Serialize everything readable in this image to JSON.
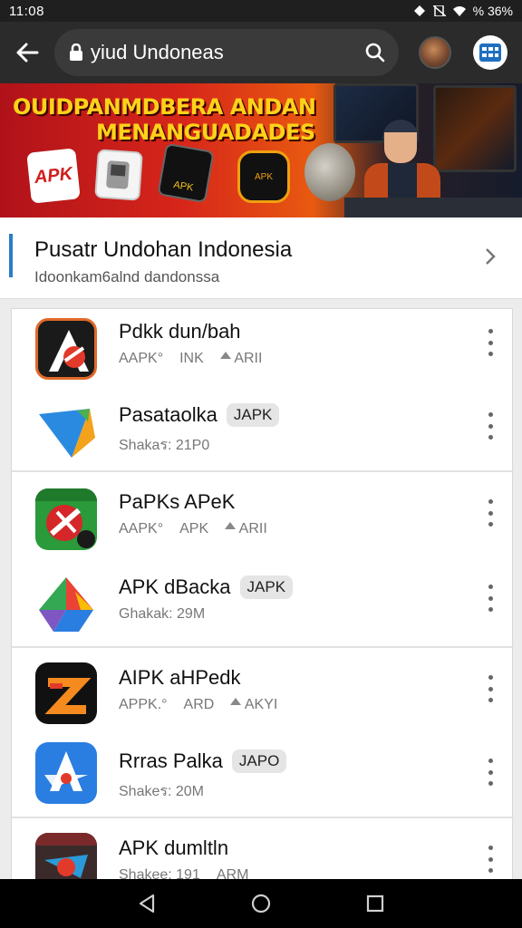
{
  "status_bar": {
    "time": "11:08",
    "battery": "% 36%"
  },
  "browser": {
    "url": "yiud Undoneas",
    "avatar_icon": "profile-avatar",
    "apps_icon": "apps-grid-icon"
  },
  "banner": {
    "title_line1": "OUIDPANMDBERA ANDAN",
    "title_line2": "MENANGUADADES",
    "tiles": [
      "APK",
      "",
      "APK",
      "APK"
    ]
  },
  "section": {
    "title": "Pusatr Undohan Indonesia",
    "subtitle": "Idoonkam6alnd dandonssa"
  },
  "apps": [
    {
      "name": "Pdkk dun/bah",
      "badge": "",
      "meta": [
        "AAPK°",
        "INK",
        "ARII"
      ],
      "icon_colors": [
        "#1a1a1a",
        "#e23a2a"
      ]
    },
    {
      "name": "Pasataolka",
      "badge": "JAPK",
      "meta": [
        "Shakaร: 21P0"
      ],
      "icon_colors": [
        "#2a8ae0",
        "#f2a31b"
      ]
    },
    {
      "name": "PaPKs APeK",
      "badge": "",
      "meta": [
        "AAPK°",
        "APK",
        "ARII"
      ],
      "icon_colors": [
        "#2a9a3a",
        "#d5262a"
      ]
    },
    {
      "name": "APK dBacka",
      "badge": "JAPK",
      "meta": [
        "Ghakak: 29M"
      ],
      "icon_colors": [
        "#2ea44f",
        "#f7c21a"
      ]
    },
    {
      "name": "AIPK aHPedk",
      "badge": "",
      "meta": [
        "APPK.°",
        "ARD",
        "AKYI"
      ],
      "icon_colors": [
        "#111111",
        "#f58a1f"
      ]
    },
    {
      "name": "Rrras Palka",
      "badge": "JAPO",
      "meta": [
        "Shakeร: 20M"
      ],
      "icon_colors": [
        "#2a7de1",
        "#e23a2a"
      ]
    },
    {
      "name": "APK dumltln",
      "badge": "",
      "meta": [
        "Shakee: 191",
        "ARM"
      ],
      "icon_colors": [
        "#3a2a2a",
        "#e23a2a"
      ]
    }
  ],
  "accent_color": "#2a7dc6"
}
